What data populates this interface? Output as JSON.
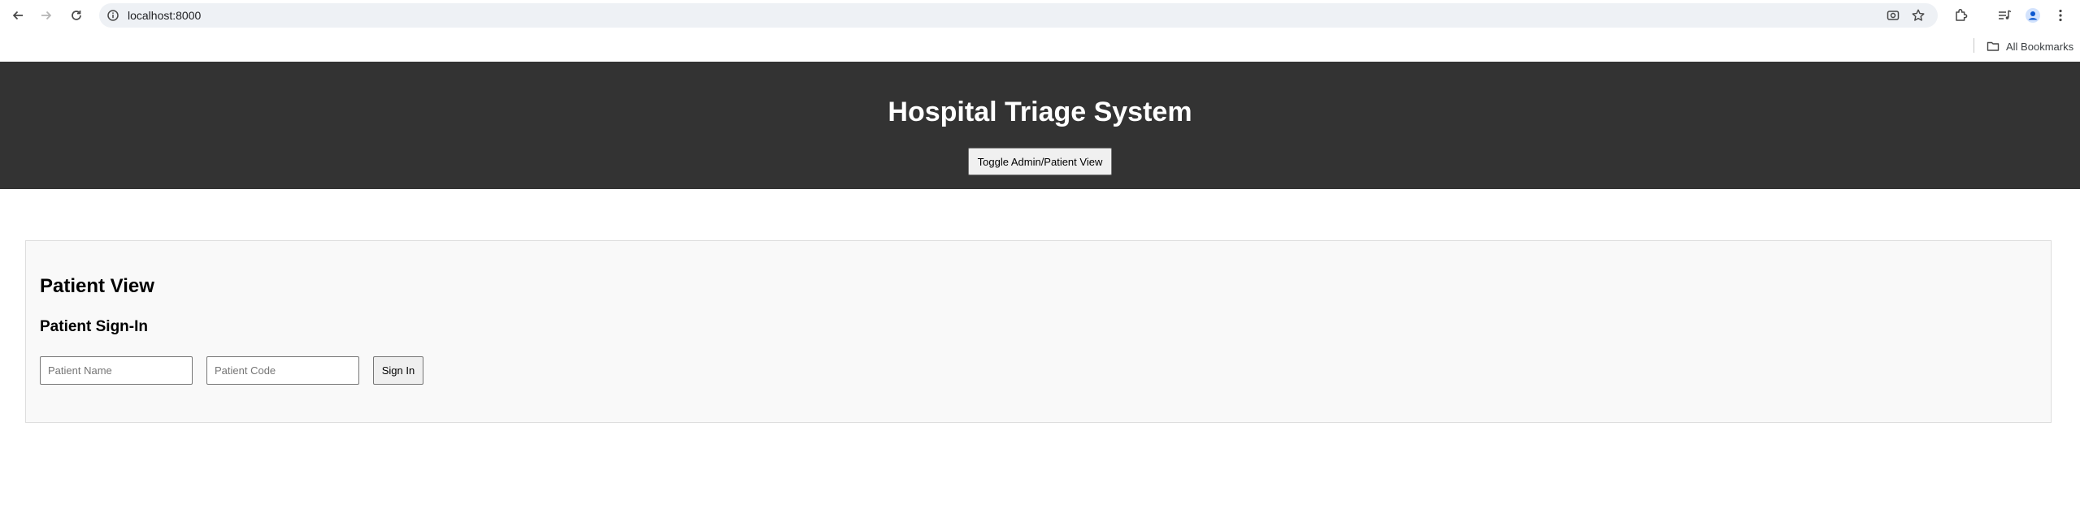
{
  "browser": {
    "url": "localhost:8000",
    "bookmarks_label": "All Bookmarks",
    "icons": [
      "back-arrow-icon",
      "forward-arrow-icon",
      "reload-icon",
      "site-info-icon",
      "screenshot-icon",
      "star-icon",
      "extensions-icon",
      "media-controls-icon",
      "profile-avatar-icon",
      "kebab-menu-icon",
      "folder-icon"
    ]
  },
  "header": {
    "title": "Hospital Triage System",
    "toggle_label": "Toggle Admin/Patient View",
    "background": "#333333"
  },
  "main": {
    "view_title": "Patient View",
    "signin_title": "Patient Sign-In",
    "name_placeholder": "Patient Name",
    "name_value": "",
    "code_placeholder": "Patient Code",
    "code_value": "",
    "signin_label": "Sign In",
    "panel_background": "#f9f9f9"
  }
}
